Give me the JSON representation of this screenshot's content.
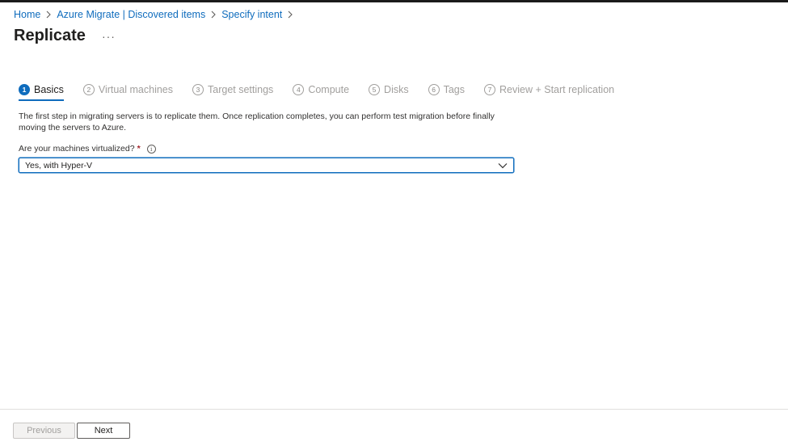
{
  "breadcrumb": {
    "items": [
      "Home",
      "Azure Migrate | Discovered items",
      "Specify intent"
    ]
  },
  "page": {
    "title": "Replicate",
    "more_label": "···"
  },
  "steps": [
    {
      "num": "1",
      "label": "Basics"
    },
    {
      "num": "2",
      "label": "Virtual machines"
    },
    {
      "num": "3",
      "label": "Target settings"
    },
    {
      "num": "4",
      "label": "Compute"
    },
    {
      "num": "5",
      "label": "Disks"
    },
    {
      "num": "6",
      "label": "Tags"
    },
    {
      "num": "7",
      "label": "Review + Start replication"
    }
  ],
  "active_step": "Basics",
  "description": "The first step in migrating servers is to replicate them. Once replication completes, you can perform test migration before finally moving the servers to Azure.",
  "form": {
    "virtualized_label": "Are your machines virtualized?",
    "required_mark": "*",
    "info_glyph": "i",
    "virtualized_value": "Yes, with Hyper-V"
  },
  "footer": {
    "previous_label": "Previous",
    "next_label": "Next"
  },
  "colors": {
    "accent": "#0f6cbd",
    "required": "#a4262c"
  }
}
